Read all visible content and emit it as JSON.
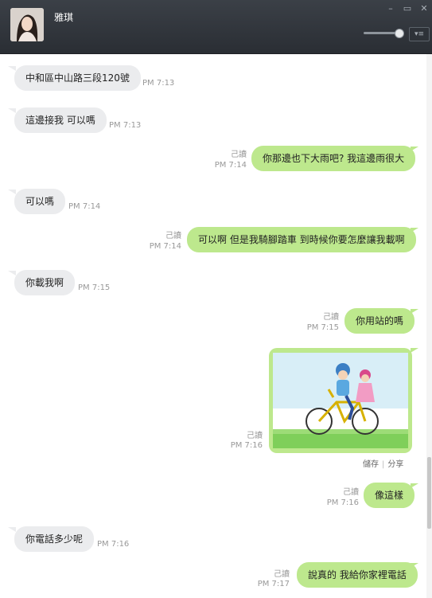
{
  "window": {
    "contact_name": "雅琪",
    "icons": [
      "avatar-photo",
      "minimize-icon",
      "maximize-icon",
      "close-icon",
      "menu-icon"
    ]
  },
  "colors": {
    "header": "#2f3338",
    "incoming": "#ebecee",
    "outgoing": "#bde88d"
  },
  "messages": [
    {
      "dir": "in",
      "text": "中和區中山路三段120號",
      "time": "PM 7:13"
    },
    {
      "dir": "in",
      "text": "這邊接我 可以嗎",
      "time": "PM 7:13"
    },
    {
      "dir": "out",
      "text": "你那邊也下大雨吧? 我這邊雨很大",
      "time": "PM 7:14",
      "read": "己讀"
    },
    {
      "dir": "in",
      "text": "可以嗎",
      "time": "PM 7:14"
    },
    {
      "dir": "out",
      "text": "可以啊 但是我騎腳踏車 到時候你要怎麼讓我載啊",
      "time": "PM 7:14",
      "read": "己讀"
    },
    {
      "dir": "in",
      "text": "你載我啊",
      "time": "PM 7:15"
    },
    {
      "dir": "out",
      "text": "你用站的嗎",
      "time": "PM 7:15",
      "read": "己讀"
    },
    {
      "dir": "out",
      "type": "image",
      "image": "two-kids-on-bicycle",
      "time": "PM 7:16",
      "read": "己讀",
      "actions": [
        "儲存",
        "分享"
      ]
    },
    {
      "dir": "out",
      "text": "像這樣",
      "time": "PM 7:16",
      "read": "己讀"
    },
    {
      "dir": "in",
      "text": "你電話多少呢",
      "time": "PM 7:16"
    },
    {
      "dir": "out",
      "text": "說真的 我給你家裡電話",
      "time": "PM 7:17",
      "read": "己讀"
    }
  ]
}
